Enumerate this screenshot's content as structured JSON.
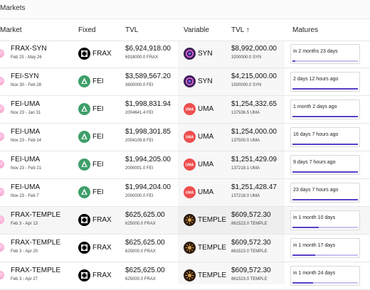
{
  "header": {
    "title": "Markets"
  },
  "columns": {
    "market": "Market",
    "fixed": "Fixed",
    "tvl": "TVL",
    "variable": "Variable",
    "tvl_sorted": "TVL",
    "sort_indicator": "↑",
    "matures": "Matures"
  },
  "colors": {
    "accent": "#5a3ec8",
    "track": "#c9c2ef",
    "frax": "#000000",
    "fei": "#3e9f6a",
    "uma": "#ee4e4e",
    "syn": "#3b1f5a",
    "temple": "#2b1a0e"
  },
  "rows": [
    {
      "name": "FRAX-SYN",
      "dates": "Feb 25 - May 26",
      "fixed_icon": "frax-icon",
      "fixed": "FRAX",
      "tvl": "$6,924,918.00",
      "tvl_sub": "6918000.0 FRAX",
      "var_icon": "syn-icon",
      "variable": "SYN",
      "var_tvl": "$8,992,000.00",
      "var_tvl_sub": "3200000.0 SYN",
      "matures": "in 2 months 23 days",
      "progress": 0.04,
      "highlight": false
    },
    {
      "name": "FEI-SYN",
      "dates": "Nov 30 - Feb 28",
      "fixed_icon": "fei-icon",
      "fixed": "FEI",
      "tvl": "$3,589,567.20",
      "tvl_sub": "3600000.0 FEI",
      "var_icon": "syn-icon",
      "variable": "SYN",
      "var_tvl": "$4,215,000.00",
      "var_tvl_sub": "1500000.0 SYN",
      "matures": "2 days 12 hours ago",
      "progress": 1.0,
      "highlight": false
    },
    {
      "name": "FEI-UMA",
      "dates": "Nov 23 - Jan 31",
      "fixed_icon": "fei-icon",
      "fixed": "FEI",
      "tvl": "$1,998,831.94",
      "tvl_sub": "2004641.4 FEI",
      "var_icon": "uma-icon",
      "variable": "UMA",
      "var_tvl": "$1,254,332.65",
      "var_tvl_sub": "137536.5 UMA",
      "matures": "1 month 2 days ago",
      "progress": 1.0,
      "highlight": false
    },
    {
      "name": "FEI-UMA",
      "dates": "Nov 23 - Feb 14",
      "fixed_icon": "fei-icon",
      "fixed": "FEI",
      "tvl": "$1,998,301.85",
      "tvl_sub": "2004109.8 FEI",
      "var_icon": "uma-icon",
      "variable": "UMA",
      "var_tvl": "$1,254,000.00",
      "var_tvl_sub": "137500.0 UMA",
      "matures": "16 days 7 hours ago",
      "progress": 1.0,
      "highlight": false
    },
    {
      "name": "FEI-UMA",
      "dates": "Nov 23 - Feb 21",
      "fixed_icon": "fei-icon",
      "fixed": "FEI",
      "tvl": "$1,994,205.00",
      "tvl_sub": "2000001.0 FEI",
      "var_icon": "uma-icon",
      "variable": "UMA",
      "var_tvl": "$1,251,429.09",
      "var_tvl_sub": "137218.1 UMA",
      "matures": "9 days 7 hours ago",
      "progress": 1.0,
      "highlight": false
    },
    {
      "name": "FEI-UMA",
      "dates": "Nov 23 - Feb 7",
      "fixed_icon": "fei-icon",
      "fixed": "FEI",
      "tvl": "$1,994,204.00",
      "tvl_sub": "2000000.0 FEI",
      "var_icon": "uma-icon",
      "variable": "UMA",
      "var_tvl": "$1,251,428.47",
      "var_tvl_sub": "137218.0 UMA",
      "matures": "23 days 7 hours ago",
      "progress": 1.0,
      "highlight": false
    },
    {
      "name": "FRAX-TEMPLE",
      "dates": "Feb 3 - Apr 13",
      "fixed_icon": "frax-icon",
      "fixed": "FRAX",
      "tvl": "$625,625.00",
      "tvl_sub": "625000.0 FRAX",
      "var_icon": "temple-icon",
      "variable": "TEMPLE",
      "var_tvl": "$609,572.30",
      "var_tvl_sub": "861523.0 TEMPLE",
      "matures": "in 1 month 10 days",
      "progress": 0.4,
      "highlight": true
    },
    {
      "name": "FRAX-TEMPLE",
      "dates": "Feb 3 - Apr 20",
      "fixed_icon": "frax-icon",
      "fixed": "FRAX",
      "tvl": "$625,625.00",
      "tvl_sub": "625000.0 FRAX",
      "var_icon": "temple-icon",
      "variable": "TEMPLE",
      "var_tvl": "$609,572.30",
      "var_tvl_sub": "861523.0 TEMPLE",
      "matures": "in 1 month 17 days",
      "progress": 0.35,
      "highlight": false
    },
    {
      "name": "FRAX-TEMPLE",
      "dates": "Feb 3 - Apr 27",
      "fixed_icon": "frax-icon",
      "fixed": "FRAX",
      "tvl": "$625,625.00",
      "tvl_sub": "625000.0 FRAX",
      "var_icon": "temple-icon",
      "variable": "TEMPLE",
      "var_tvl": "$609,572.30",
      "var_tvl_sub": "861523.0 TEMPLE",
      "matures": "in 1 month 24 days",
      "progress": 0.31,
      "highlight": false
    }
  ]
}
